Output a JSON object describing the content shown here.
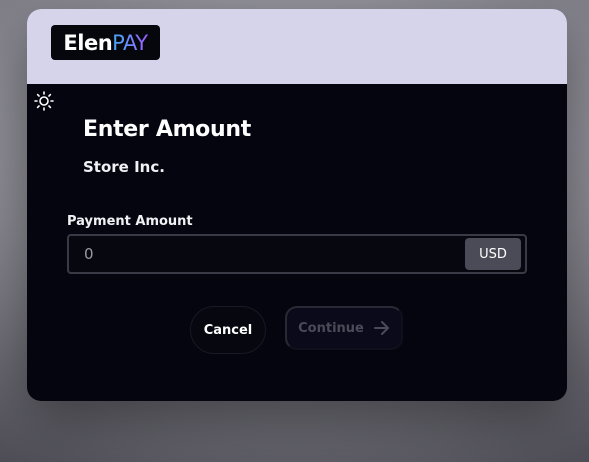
{
  "brand": {
    "logo_part1": "Elen",
    "logo_part2": "PAY"
  },
  "page": {
    "title": "Enter Amount",
    "merchant": "Store Inc."
  },
  "payment_field": {
    "label": "Payment Amount",
    "placeholder": "0",
    "value": "",
    "currency": "USD"
  },
  "actions": {
    "cancel_label": "Cancel",
    "continue_label": "Continue",
    "continue_icon": "arrow-right-icon"
  },
  "controls": {
    "theme_toggle_icon": "sun-icon"
  },
  "colors": {
    "header_bg": "#d6d4ea",
    "card_bg": "#050510",
    "currency_bg": "#4b4b57",
    "logo_pay_gradient": [
      "#3fa9f5",
      "#9d5cff"
    ]
  }
}
